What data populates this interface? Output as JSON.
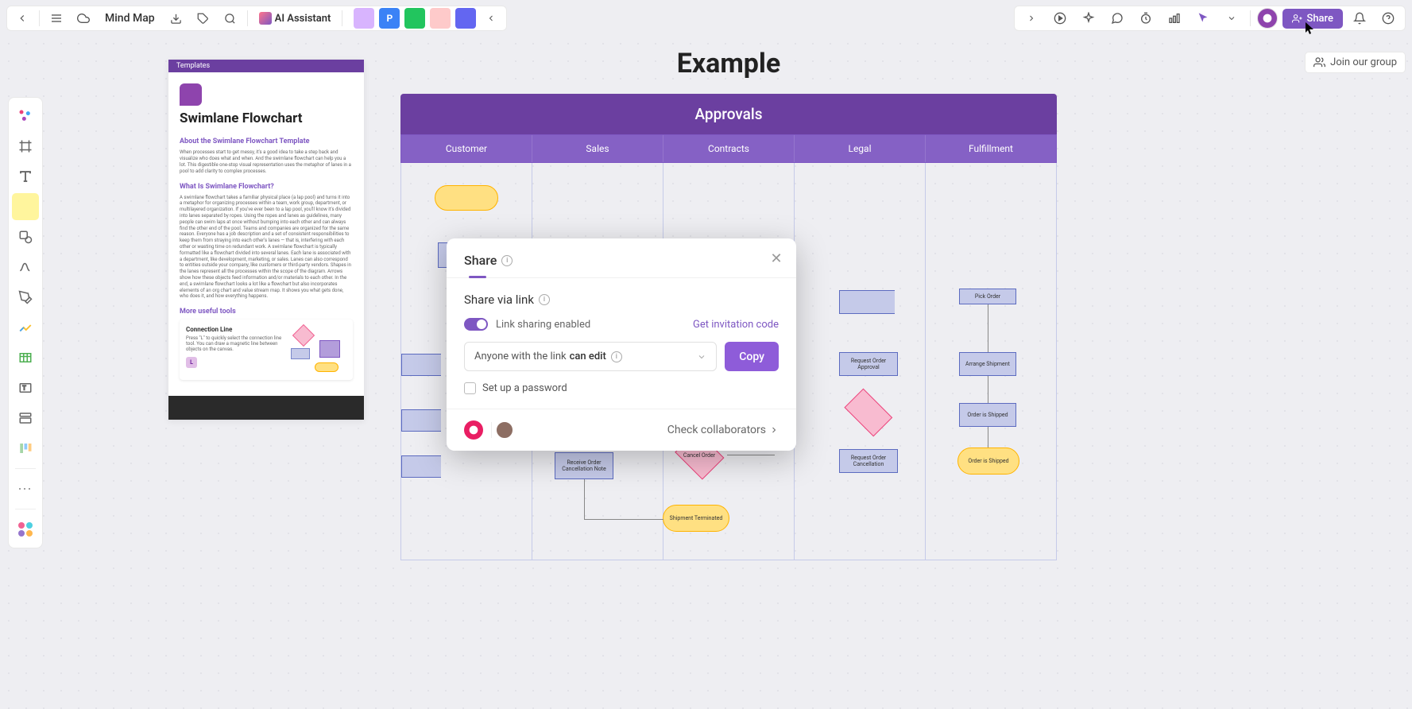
{
  "topbar": {
    "title": "Mind Map",
    "ai_label": "AI Assistant",
    "share_label": "Share",
    "dock": [
      "",
      "P",
      "",
      "",
      ""
    ]
  },
  "join_group": "Join our group",
  "template": {
    "badge": "Templates",
    "title": "Swimlane Flowchart",
    "about_h": "About the Swimlane Flowchart Template",
    "about_p": "When processes start to get messy, it's a good idea to take a step back and visualize who does what and when. And the swimlane flowchart can help you a lot. This digestible one-stop visual representation uses the metaphor of lanes in a pool to add clarity to complex processes.",
    "what_h": "What Is Swimlane Flowchart?",
    "what_p": "A swimlane flowchart takes a familiar physical place (a lap pool) and turns it into a metaphor for organizing processes within a team, work group, department, or multilayered organization. If you've ever been to a lap pool, you'll know it's divided into lanes separated by ropes. Using the ropes and lanes as guidelines, many people can swim laps at once without bumping into each other and can always find the other end of the pool. Teams and companies are organized for the same reason. Everyone has a job description and a set of consistent responsibilities to keep them from straying into each other's lanes — that is, interfering with each other or wasting time on redundant work. A swimlane flowchart is typically formatted like a flowchart divided into several lanes. Each lane is associated with a department, like development, marketing, or sales. Lanes can also correspond to entities outside your company, like customers or third-party vendors. Shapes in the lanes represent all the processes within the scope of the diagram. Arrows show how these objects feed information and/or materials to each other. In the end, a swimlane flowchart looks a lot like a flowchart but also incorporates elements of an org chart and value stream map. It shows you what gets done, who does it, and how everything happens.",
    "more_h": "More useful tools",
    "conn_title": "Connection Line",
    "conn_p": "Press \"L\" to quickly select the connection line tool. You can draw a magnetic line between objects on the canvas.",
    "conn_key": "L"
  },
  "board": {
    "title": "Example",
    "header": "Approvals",
    "lanes": [
      "Customer",
      "Sales",
      "Contracts",
      "Legal",
      "Fulfillment"
    ],
    "nodes": {
      "pick": "Pick Order",
      "req_approval": "Request Order Approval",
      "arrange": "Arrange Shipment",
      "shipped": "Order is Shipped",
      "order_shipped": "Order is Shipped",
      "req_cancel": "Request Order Cancellation",
      "cancel_order": "Cancel Order",
      "receive_cancel": "Receive Order Cancellation Note",
      "ship_term": "Shipment Terminated"
    }
  },
  "modal": {
    "title": "Share",
    "section": "Share via link",
    "toggle_label": "Link sharing enabled",
    "invite": "Get invitation code",
    "perm_prefix": "Anyone with the link",
    "perm_value": "can edit",
    "copy": "Copy",
    "password": "Set up a password",
    "collab": "Check collaborators"
  }
}
